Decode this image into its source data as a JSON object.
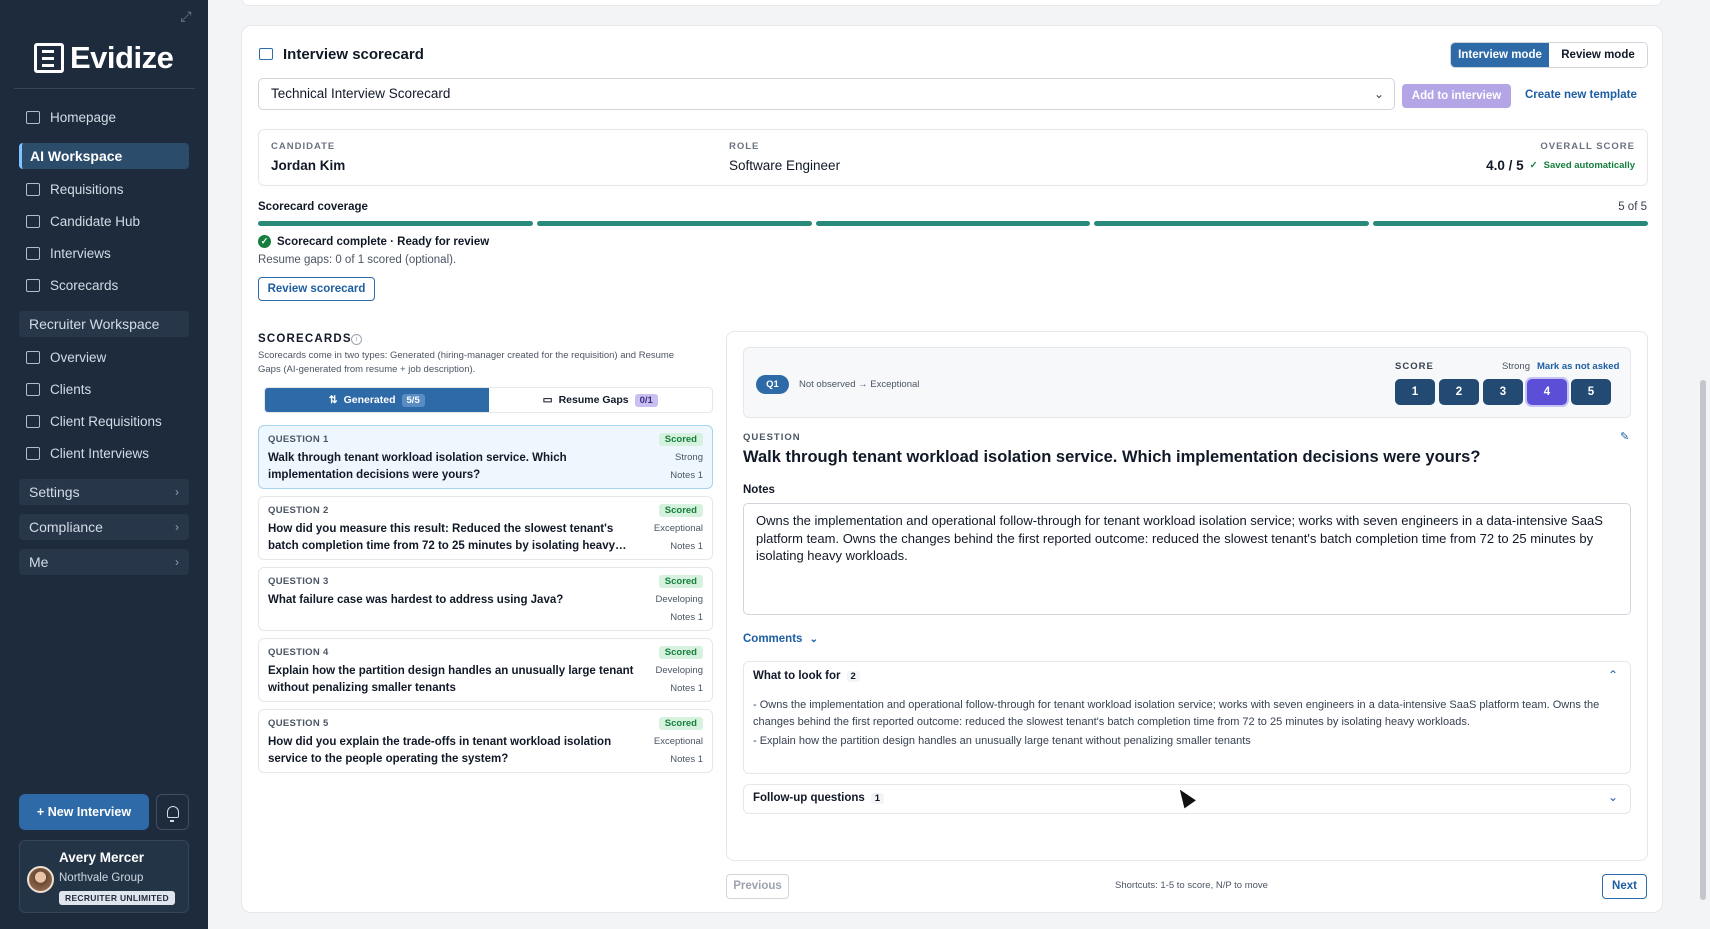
{
  "app": {
    "name": "Evidize"
  },
  "sidebar": {
    "items": [
      {
        "label": "Homepage",
        "icon": "home-icon"
      },
      {
        "label": "AI Workspace",
        "active": true
      },
      {
        "label": "Requisitions",
        "icon": "briefcase-icon"
      },
      {
        "label": "Candidate Hub",
        "icon": "user-search-icon"
      },
      {
        "label": "Interviews",
        "icon": "calendar-icon"
      },
      {
        "label": "Scorecards",
        "icon": "clipboard-icon"
      },
      {
        "label": "Recruiter Workspace",
        "group": true
      },
      {
        "label": "Overview",
        "icon": "grid-icon"
      },
      {
        "label": "Clients",
        "icon": "building-icon"
      },
      {
        "label": "Client Requisitions",
        "icon": "briefcase-icon"
      },
      {
        "label": "Client Interviews",
        "icon": "calendar-icon"
      }
    ],
    "groups": [
      {
        "label": "Settings"
      },
      {
        "label": "Compliance"
      },
      {
        "label": "Me"
      }
    ],
    "new_interview_label": "+ New Interview",
    "user": {
      "name": "Avery Mercer",
      "org": "Northvale Group",
      "badge": "RECRUITER UNLIMITED"
    }
  },
  "scorecard": {
    "title": "Interview scorecard",
    "modes": [
      "Interview mode",
      "Review mode"
    ],
    "active_mode": "Interview mode",
    "template": "Technical Interview Scorecard",
    "add_label": "Add to interview",
    "create_label": "Create new template",
    "candidate": {
      "label": "CANDIDATE",
      "value": "Jordan Kim"
    },
    "role": {
      "label": "ROLE",
      "value": "Software Engineer"
    },
    "overall": {
      "label": "OVERALL SCORE",
      "value": "4.0 / 5",
      "saved": "Saved automatically"
    },
    "coverage": {
      "title": "Scorecard coverage",
      "count": "5 of 5",
      "segments_filled": 5,
      "segments_total": 5,
      "status": "Scorecard complete · Ready for review",
      "gaps": "Resume gaps: 0 of 1 scored (optional).",
      "review_label": "Review scorecard"
    }
  },
  "list": {
    "heading": "SCORECARDS",
    "description": "Scorecards come in two types: Generated (hiring-manager created for the requisition) and Resume Gaps (AI-generated from resume + job description).",
    "tabs": [
      {
        "label": "Generated",
        "count": "5/5"
      },
      {
        "label": "Resume Gaps",
        "count": "0/1"
      }
    ],
    "questions": [
      {
        "num": "QUESTION 1",
        "text": "Walk through tenant workload isolation service. Which implementation decisions were yours?",
        "status": "Scored",
        "rating": "Strong",
        "notes": "Notes 1"
      },
      {
        "num": "QUESTION 2",
        "text": "How did you measure this result: Reduced the slowest tenant's batch completion time from 72 to 25 minutes by isolating heavy…",
        "status": "Scored",
        "rating": "Exceptional",
        "notes": "Notes 1"
      },
      {
        "num": "QUESTION 3",
        "text": "What failure case was hardest to address using Java?",
        "status": "Scored",
        "rating": "Developing",
        "notes": "Notes 1"
      },
      {
        "num": "QUESTION 4",
        "text": "Explain how the partition design handles an unusually large tenant without penalizing smaller tenants",
        "status": "Scored",
        "rating": "Developing",
        "notes": "Notes 1"
      },
      {
        "num": "QUESTION 5",
        "text": "How did you explain the trade-offs in tenant workload isolation service to the people operating the system?",
        "status": "Scored",
        "rating": "Exceptional",
        "notes": "Notes 1"
      }
    ]
  },
  "detail": {
    "q_pill": "Q1",
    "range": "Not observed → Exceptional",
    "score_label": "SCORE",
    "score_word": "Strong",
    "mark_not_asked": "Mark as not asked",
    "scores": [
      "1",
      "2",
      "3",
      "4",
      "5"
    ],
    "selected_score": 4,
    "question_label": "QUESTION",
    "question": "Walk through tenant workload isolation service. Which implementation decisions were yours?",
    "notes_label": "Notes",
    "notes": "Owns the implementation and operational follow-through for tenant workload isolation service; works with seven engineers in a data-intensive SaaS platform team. Owns the changes behind the first reported outcome: reduced the slowest tenant's batch completion time from 72 to 25 minutes by isolating heavy workloads.",
    "comments_label": "Comments",
    "look_for": {
      "label": "What to look for",
      "count": "2",
      "items": [
        "- Owns the implementation and operational follow-through for tenant workload isolation service; works with seven engineers in a data-intensive SaaS platform team. Owns the changes behind the first reported outcome: reduced the slowest tenant's batch completion time from 72 to 25 minutes by isolating heavy workloads.",
        "- Explain how the partition design handles an unusually large tenant without penalizing smaller tenants"
      ]
    },
    "follow_up": {
      "label": "Follow-up questions",
      "count": "1"
    }
  },
  "footer": {
    "previous": "Previous",
    "shortcuts": "Shortcuts: 1-5 to score, N/P to move",
    "next": "Next"
  }
}
